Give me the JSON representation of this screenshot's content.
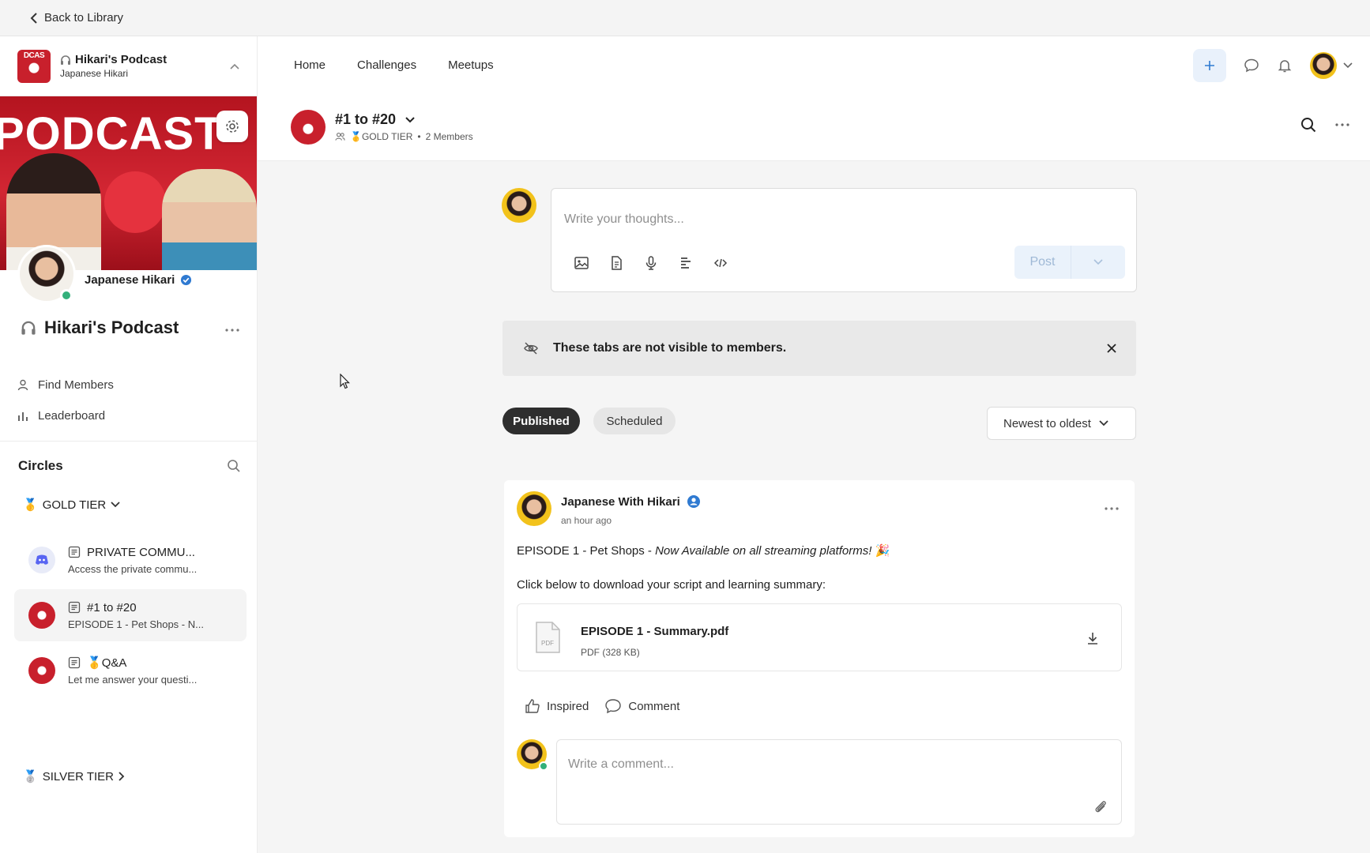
{
  "topbar": {
    "back_label": "Back to Library"
  },
  "sidebar": {
    "community_name": "Hikari's Podcast",
    "community_owner": "Japanese Hikari",
    "cover_word": "PODCAST",
    "logo_text": "DCAS",
    "profile_name": "Japanese Hikari",
    "space_title": "Hikari's Podcast",
    "links": [
      {
        "label": "Find Members",
        "icon": "person-icon"
      },
      {
        "label": "Leaderboard",
        "icon": "bar-chart-icon"
      }
    ],
    "circles_heading": "Circles",
    "gold_tier": {
      "emoji": "🥇",
      "label": "GOLD TIER"
    },
    "circles": [
      {
        "title": "PRIVATE COMMU...",
        "subtitle": "Access the private commu..."
      },
      {
        "title": "#1 to #20",
        "subtitle": "EPISODE 1 - Pet Shops - N..."
      },
      {
        "title": "Q&A",
        "emoji": "🥇",
        "subtitle": "Let me answer your questi..."
      }
    ],
    "silver_tier": {
      "emoji": "🥈",
      "label": "SILVER TIER"
    }
  },
  "nav": {
    "items": [
      "Home",
      "Challenges",
      "Meetups"
    ]
  },
  "channel": {
    "title": "#1 to #20",
    "tier": "GOLD TIER",
    "tier_emoji": "🥇",
    "separator": "•",
    "members": "2 Members"
  },
  "composer": {
    "placeholder": "Write your thoughts...",
    "post_label": "Post"
  },
  "notice": {
    "text": "These tabs are not visible to members."
  },
  "tabs": {
    "published": "Published",
    "scheduled": "Scheduled"
  },
  "sort": {
    "selected": "Newest to oldest"
  },
  "post": {
    "author": "Japanese With Hikari",
    "time": "an hour ago",
    "line1_bold": "EPISODE 1",
    "line1_rest": " - Pet Shops - ",
    "line1_italic": "Now Available on all streaming platforms!",
    "line1_emoji": " 🎉",
    "line2": "Click below to download your script and learning summary:",
    "file_name": "EPISODE 1 - Summary.pdf",
    "file_size": "PDF (328 KB)",
    "file_icon_label": "PDF",
    "react_label": "Inspired",
    "comment_label": "Comment",
    "comment_placeholder": "Write a comment..."
  },
  "colors": {
    "accent": "#2f7ad1",
    "brand_red": "#c8202c",
    "online": "#33b07a",
    "dark_pill": "#2e2e2e"
  }
}
